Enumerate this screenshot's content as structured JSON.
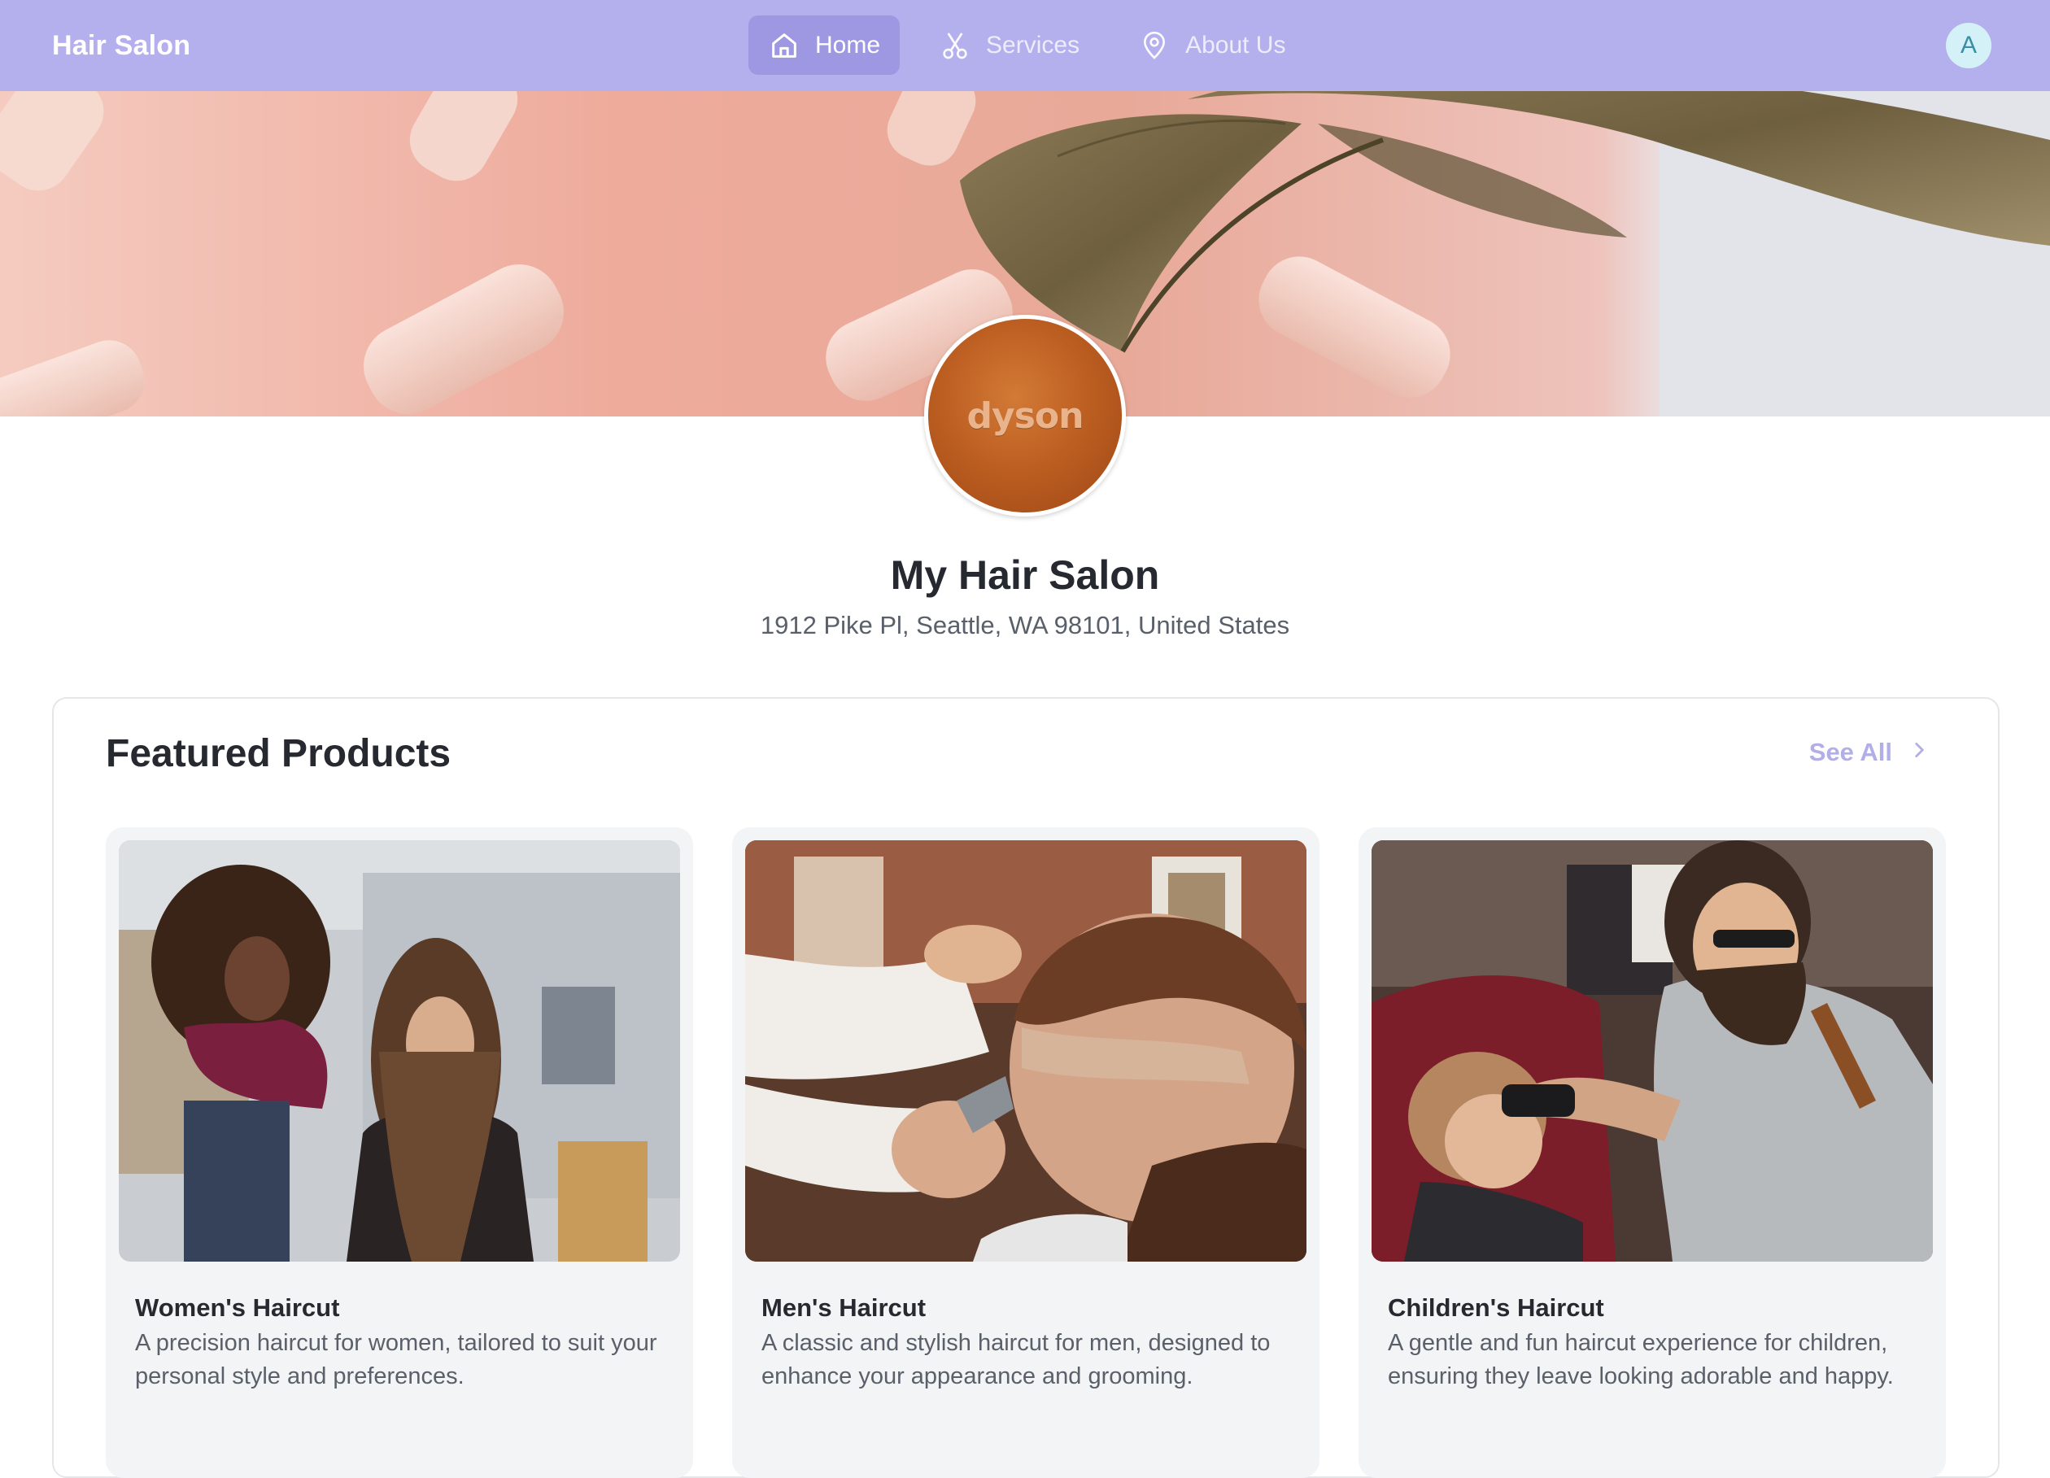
{
  "nav": {
    "brand": "Hair Salon",
    "items": [
      {
        "label": "Home",
        "icon": "home-icon",
        "active": true
      },
      {
        "label": "Services",
        "icon": "scissors-icon",
        "active": false
      },
      {
        "label": "About Us",
        "icon": "map-pin-icon",
        "active": false
      }
    ],
    "avatar_initial": "A"
  },
  "profile": {
    "logo_text": "dyson",
    "name": "My Hair Salon",
    "address": "1912 Pike Pl, Seattle, WA 98101, United States"
  },
  "featured": {
    "title": "Featured Products",
    "see_all_label": "See All",
    "products": [
      {
        "name": "Women's Haircut",
        "description": "A precision haircut for women, tailored to suit your personal style and preferences."
      },
      {
        "name": "Men's Haircut",
        "description": "A classic and stylish haircut for men, designed to enhance your appearance and grooming."
      },
      {
        "name": "Children's Haircut",
        "description": "A gentle and fun haircut experience for children, ensuring they leave looking adorable and happy."
      }
    ]
  },
  "colors": {
    "nav_bg": "#b4b0ee",
    "nav_active_bg": "#9e98e3",
    "see_all": "#b2aee8",
    "card_bg": "#f3f4f6"
  }
}
